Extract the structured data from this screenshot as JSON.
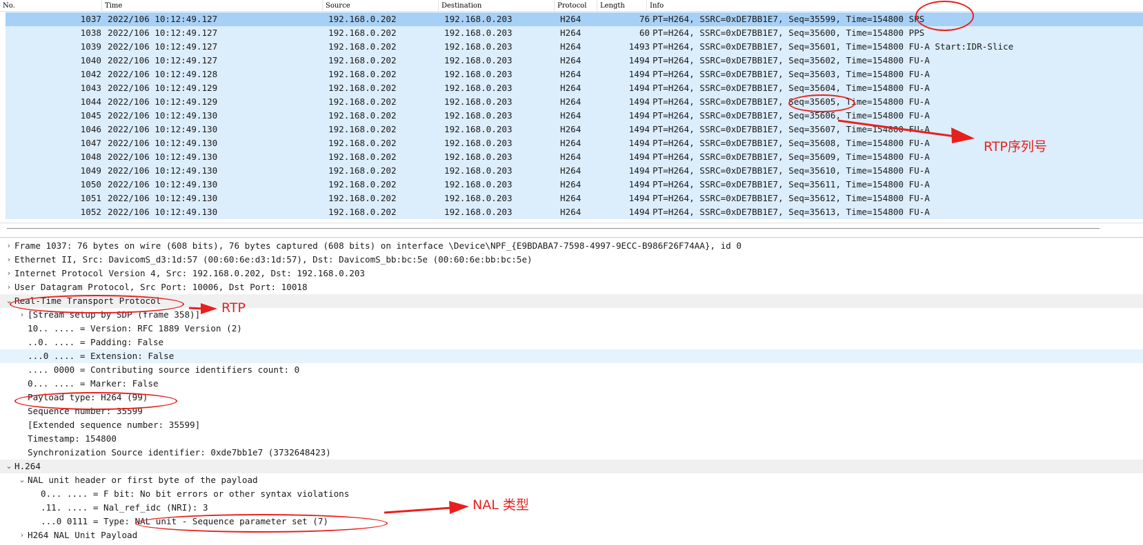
{
  "packet_list": {
    "columns": [
      "No.",
      "Time",
      "Source",
      "Destination",
      "Protocol",
      "Length",
      "Info"
    ],
    "rows": [
      {
        "no": "1037",
        "time": "2022/106 10:12:49.127",
        "src": "192.168.0.202",
        "dst": "192.168.0.203",
        "proto": "H264",
        "len": "76",
        "info": "PT=H264, SSRC=0xDE7BB1E7, Seq=35599, Time=154800 SPS"
      },
      {
        "no": "1038",
        "time": "2022/106 10:12:49.127",
        "src": "192.168.0.202",
        "dst": "192.168.0.203",
        "proto": "H264",
        "len": "60",
        "info": "PT=H264, SSRC=0xDE7BB1E7, Seq=35600, Time=154800 PPS"
      },
      {
        "no": "1039",
        "time": "2022/106 10:12:49.127",
        "src": "192.168.0.202",
        "dst": "192.168.0.203",
        "proto": "H264",
        "len": "1493",
        "info": "PT=H264, SSRC=0xDE7BB1E7, Seq=35601, Time=154800 FU-A Start:IDR-Slice"
      },
      {
        "no": "1040",
        "time": "2022/106 10:12:49.127",
        "src": "192.168.0.202",
        "dst": "192.168.0.203",
        "proto": "H264",
        "len": "1494",
        "info": "PT=H264, SSRC=0xDE7BB1E7, Seq=35602, Time=154800 FU-A"
      },
      {
        "no": "1042",
        "time": "2022/106 10:12:49.128",
        "src": "192.168.0.202",
        "dst": "192.168.0.203",
        "proto": "H264",
        "len": "1494",
        "info": "PT=H264, SSRC=0xDE7BB1E7, Seq=35603, Time=154800 FU-A"
      },
      {
        "no": "1043",
        "time": "2022/106 10:12:49.129",
        "src": "192.168.0.202",
        "dst": "192.168.0.203",
        "proto": "H264",
        "len": "1494",
        "info": "PT=H264, SSRC=0xDE7BB1E7, Seq=35604, Time=154800 FU-A"
      },
      {
        "no": "1044",
        "time": "2022/106 10:12:49.129",
        "src": "192.168.0.202",
        "dst": "192.168.0.203",
        "proto": "H264",
        "len": "1494",
        "info": "PT=H264, SSRC=0xDE7BB1E7, Seq=35605, Time=154800 FU-A"
      },
      {
        "no": "1045",
        "time": "2022/106 10:12:49.130",
        "src": "192.168.0.202",
        "dst": "192.168.0.203",
        "proto": "H264",
        "len": "1494",
        "info": "PT=H264, SSRC=0xDE7BB1E7, Seq=35606, Time=154800 FU-A"
      },
      {
        "no": "1046",
        "time": "2022/106 10:12:49.130",
        "src": "192.168.0.202",
        "dst": "192.168.0.203",
        "proto": "H264",
        "len": "1494",
        "info": "PT=H264, SSRC=0xDE7BB1E7, Seq=35607, Time=154800 FU-A"
      },
      {
        "no": "1047",
        "time": "2022/106 10:12:49.130",
        "src": "192.168.0.202",
        "dst": "192.168.0.203",
        "proto": "H264",
        "len": "1494",
        "info": "PT=H264, SSRC=0xDE7BB1E7, Seq=35608, Time=154800 FU-A"
      },
      {
        "no": "1048",
        "time": "2022/106 10:12:49.130",
        "src": "192.168.0.202",
        "dst": "192.168.0.203",
        "proto": "H264",
        "len": "1494",
        "info": "PT=H264, SSRC=0xDE7BB1E7, Seq=35609, Time=154800 FU-A"
      },
      {
        "no": "1049",
        "time": "2022/106 10:12:49.130",
        "src": "192.168.0.202",
        "dst": "192.168.0.203",
        "proto": "H264",
        "len": "1494",
        "info": "PT=H264, SSRC=0xDE7BB1E7, Seq=35610, Time=154800 FU-A"
      },
      {
        "no": "1050",
        "time": "2022/106 10:12:49.130",
        "src": "192.168.0.202",
        "dst": "192.168.0.203",
        "proto": "H264",
        "len": "1494",
        "info": "PT=H264, SSRC=0xDE7BB1E7, Seq=35611, Time=154800 FU-A"
      },
      {
        "no": "1051",
        "time": "2022/106 10:12:49.130",
        "src": "192.168.0.202",
        "dst": "192.168.0.203",
        "proto": "H264",
        "len": "1494",
        "info": "PT=H264, SSRC=0xDE7BB1E7, Seq=35612, Time=154800 FU-A"
      },
      {
        "no": "1052",
        "time": "2022/106 10:12:49.130",
        "src": "192.168.0.202",
        "dst": "192.168.0.203",
        "proto": "H264",
        "len": "1494",
        "info": "PT=H264, SSRC=0xDE7BB1E7, Seq=35613, Time=154800 FU-A"
      }
    ]
  },
  "detail_tree": [
    {
      "text": "Frame 1037: 76 bytes on wire (608 bits), 76 bytes captured (608 bits) on interface \\Device\\NPF_{E9BDABA7-7598-4997-9ECC-B986F26F74AA}, id 0",
      "level": 0,
      "arrow": "collapsed"
    },
    {
      "text": "Ethernet II, Src: DavicomS_d3:1d:57 (00:60:6e:d3:1d:57), Dst: DavicomS_bb:bc:5e (00:60:6e:bb:bc:5e)",
      "level": 0,
      "arrow": "collapsed"
    },
    {
      "text": "Internet Protocol Version 4, Src: 192.168.0.202, Dst: 192.168.0.203",
      "level": 0,
      "arrow": "collapsed"
    },
    {
      "text": "User Datagram Protocol, Src Port: 10006, Dst Port: 10018",
      "level": 0,
      "arrow": "collapsed"
    },
    {
      "text": "Real-Time Transport Protocol",
      "level": 0,
      "arrow": "expanded",
      "hl": true
    },
    {
      "text": "[Stream setup by SDP (frame 358)]",
      "level": 1,
      "arrow": "collapsed"
    },
    {
      "text": "10.. .... = Version: RFC 1889 Version (2)",
      "level": 1,
      "arrow": ""
    },
    {
      "text": "..0. .... = Padding: False",
      "level": 1,
      "arrow": ""
    },
    {
      "text": "...0 .... = Extension: False",
      "level": 1,
      "arrow": "",
      "sel": true
    },
    {
      "text": ".... 0000 = Contributing source identifiers count: 0",
      "level": 1,
      "arrow": ""
    },
    {
      "text": "0... .... = Marker: False",
      "level": 1,
      "arrow": ""
    },
    {
      "text": "Payload type: H264 (99)",
      "level": 1,
      "arrow": ""
    },
    {
      "text": "Sequence number: 35599",
      "level": 1,
      "arrow": ""
    },
    {
      "text": "[Extended sequence number: 35599]",
      "level": 1,
      "arrow": ""
    },
    {
      "text": "Timestamp: 154800",
      "level": 1,
      "arrow": ""
    },
    {
      "text": "Synchronization Source identifier: 0xde7bb1e7 (3732648423)",
      "level": 1,
      "arrow": ""
    },
    {
      "text": "H.264",
      "level": 0,
      "arrow": "expanded",
      "hl": true
    },
    {
      "text": "NAL unit header or first byte of the payload",
      "level": 1,
      "arrow": "expanded"
    },
    {
      "text": "0... .... = F bit: No bit errors or other syntax violations",
      "level": 2,
      "arrow": ""
    },
    {
      "text": ".11. .... = Nal_ref_idc (NRI): 3",
      "level": 2,
      "arrow": ""
    },
    {
      "text": "...0 0111 = Type: NAL unit - Sequence parameter set (7)",
      "level": 2,
      "arrow": ""
    },
    {
      "text": "H264 NAL Unit Payload",
      "level": 1,
      "arrow": "collapsed"
    }
  ],
  "annotations": {
    "rtp_seq_label": "RTP序列号",
    "rtp_label": "RTP",
    "nal_type_label": "NAL 类型",
    "color": "#e8201d"
  },
  "icons": {
    "collapsed": "›",
    "expanded": "⌄"
  }
}
